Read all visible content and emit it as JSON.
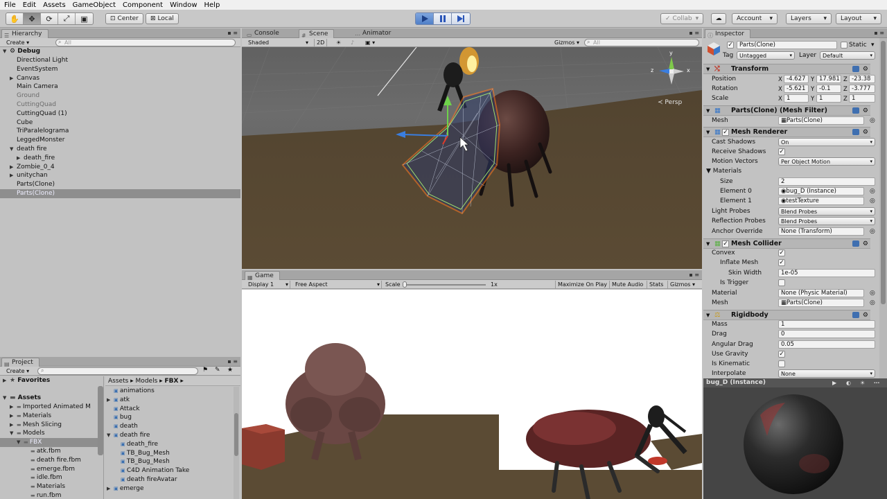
{
  "menu": [
    "File",
    "Edit",
    "Assets",
    "GameObject",
    "Component",
    "Window",
    "Help"
  ],
  "toolbar": {
    "pivot_label": "Center",
    "space_label": "Local",
    "collab_label": "Collab",
    "account_label": "Account",
    "layers_label": "Layers",
    "layout_label": "Layout"
  },
  "hierarchy": {
    "tab": "Hierarchy",
    "create": "Create",
    "search_placeholder": "All",
    "scene_name": "Debug",
    "items": [
      {
        "label": "Directional Light",
        "depth": 1,
        "dim": false,
        "arrow": ""
      },
      {
        "label": "EventSystem",
        "depth": 1,
        "dim": false,
        "arrow": ""
      },
      {
        "label": "Canvas",
        "depth": 1,
        "dim": false,
        "arrow": "▶"
      },
      {
        "label": "Main Camera",
        "depth": 1,
        "dim": false,
        "arrow": ""
      },
      {
        "label": "Ground",
        "depth": 1,
        "dim": true,
        "arrow": ""
      },
      {
        "label": "CuttingQuad",
        "depth": 1,
        "dim": true,
        "arrow": ""
      },
      {
        "label": "CuttingQuad (1)",
        "depth": 1,
        "dim": false,
        "arrow": ""
      },
      {
        "label": "Cube",
        "depth": 1,
        "dim": false,
        "arrow": ""
      },
      {
        "label": "TriParalelograma",
        "depth": 1,
        "dim": false,
        "arrow": ""
      },
      {
        "label": "LeggedMonster",
        "depth": 1,
        "dim": false,
        "arrow": ""
      },
      {
        "label": "death fire",
        "depth": 1,
        "dim": false,
        "arrow": "▼"
      },
      {
        "label": "death_fire",
        "depth": 2,
        "dim": false,
        "arrow": "▶"
      },
      {
        "label": "Zombie_0_4",
        "depth": 1,
        "dim": false,
        "arrow": "▶"
      },
      {
        "label": "unitychan",
        "depth": 1,
        "dim": false,
        "arrow": "▶"
      },
      {
        "label": "Parts(Clone)",
        "depth": 1,
        "dim": false,
        "arrow": ""
      },
      {
        "label": "Parts(Clone)",
        "depth": 1,
        "dim": false,
        "arrow": "",
        "selected": true
      }
    ]
  },
  "scene": {
    "tabs": [
      "Console",
      "Scene",
      "Animator"
    ],
    "shading": "Shaded",
    "mode_2d": "2D",
    "gizmos": "Gizmos",
    "search_placeholder": "All",
    "persp": "Persp",
    "axis_y": "y",
    "axis_x": "x",
    "axis_z": "z"
  },
  "game": {
    "tab": "Game",
    "display": "Display 1",
    "aspect": "Free Aspect",
    "scale_label": "Scale",
    "scale_value": "1x",
    "maximize": "Maximize On Play",
    "mute": "Mute Audio",
    "stats": "Stats",
    "gizmos": "Gizmos"
  },
  "project": {
    "tab": "Project",
    "create": "Create",
    "favorites": "Favorites",
    "assets_root": "Assets",
    "tree": [
      {
        "label": "Imported Animated M",
        "depth": 1,
        "arrow": "▶"
      },
      {
        "label": "Materials",
        "depth": 1,
        "arrow": "▶"
      },
      {
        "label": "Mesh Slicing",
        "depth": 1,
        "arrow": "▶"
      },
      {
        "label": "Models",
        "depth": 1,
        "arrow": "▼"
      },
      {
        "label": "FBX",
        "depth": 2,
        "arrow": "▼",
        "selected": true
      },
      {
        "label": "atk.fbm",
        "depth": 3,
        "arrow": ""
      },
      {
        "label": "death fire.fbm",
        "depth": 3,
        "arrow": ""
      },
      {
        "label": "emerge.fbm",
        "depth": 3,
        "arrow": ""
      },
      {
        "label": "idle.fbm",
        "depth": 3,
        "arrow": ""
      },
      {
        "label": "Materials",
        "depth": 3,
        "arrow": ""
      },
      {
        "label": "run.fbm",
        "depth": 3,
        "arrow": ""
      }
    ],
    "breadcrumb": [
      "Assets",
      "Models",
      "FBX"
    ],
    "files": [
      {
        "label": "animations",
        "depth": 0,
        "arrow": ""
      },
      {
        "label": "atk",
        "depth": 0,
        "arrow": "▶"
      },
      {
        "label": "Attack",
        "depth": 0,
        "arrow": ""
      },
      {
        "label": "bug",
        "depth": 0,
        "arrow": ""
      },
      {
        "label": "death",
        "depth": 0,
        "arrow": ""
      },
      {
        "label": "death fire",
        "depth": 0,
        "arrow": "▼"
      },
      {
        "label": "death_fire",
        "depth": 1,
        "arrow": ""
      },
      {
        "label": "TB_Bug_Mesh",
        "depth": 1,
        "arrow": ""
      },
      {
        "label": "TB_Bug_Mesh",
        "depth": 1,
        "arrow": ""
      },
      {
        "label": "C4D Animation Take",
        "depth": 1,
        "arrow": ""
      },
      {
        "label": "death fireAvatar",
        "depth": 1,
        "arrow": ""
      },
      {
        "label": "emerge",
        "depth": 0,
        "arrow": "▶"
      }
    ]
  },
  "inspector": {
    "tab": "Inspector",
    "object_name": "Parts(Clone)",
    "static_label": "Static",
    "tag_label": "Tag",
    "tag_value": "Untagged",
    "layer_label": "Layer",
    "layer_value": "Default",
    "transform": {
      "title": "Transform",
      "position_label": "Position",
      "position": [
        "-4.627",
        "17.981",
        "-23.38"
      ],
      "rotation_label": "Rotation",
      "rotation": [
        "-5.621",
        "-0.1",
        "-3.777"
      ],
      "scale_label": "Scale",
      "scale": [
        "1",
        "1",
        "1"
      ]
    },
    "mesh_filter": {
      "title": "Parts(Clone) (Mesh Filter)",
      "mesh_label": "Mesh",
      "mesh_value": "Parts(Clone)"
    },
    "mesh_renderer": {
      "title": "Mesh Renderer",
      "cast_shadows_label": "Cast Shadows",
      "cast_shadows": "On",
      "receive_shadows_label": "Receive Shadows",
      "motion_vectors_label": "Motion Vectors",
      "motion_vectors": "Per Object Motion",
      "materials_label": "Materials",
      "size_label": "Size",
      "size": "2",
      "element0_label": "Element 0",
      "element0": "bug_D (Instance)",
      "element1_label": "Element 1",
      "element1": "testTexture",
      "light_probes_label": "Light Probes",
      "light_probes": "Blend Probes",
      "reflection_probes_label": "Reflection Probes",
      "reflection_probes": "Blend Probes",
      "anchor_override_label": "Anchor Override",
      "anchor_override": "None (Transform)"
    },
    "mesh_collider": {
      "title": "Mesh Collider",
      "convex_label": "Convex",
      "inflate_label": "Inflate Mesh",
      "skin_width_label": "Skin Width",
      "skin_width": "1e-05",
      "is_trigger_label": "Is Trigger",
      "material_label": "Material",
      "material": "None (Physic Material)",
      "mesh_label": "Mesh",
      "mesh": "Parts(Clone)"
    },
    "rigidbody": {
      "title": "Rigidbody",
      "mass_label": "Mass",
      "mass": "1",
      "drag_label": "Drag",
      "drag": "0",
      "angular_drag_label": "Angular Drag",
      "angular_drag": "0.05",
      "use_gravity_label": "Use Gravity",
      "is_kinematic_label": "Is Kinematic",
      "interpolate_label": "Interpolate",
      "interpolate": "None"
    },
    "preview_title": "bug_D (Instance)"
  },
  "colors": {
    "accent": "#4f7fc8",
    "selection": "#8e8e8e",
    "ground": "#5a4b35"
  }
}
